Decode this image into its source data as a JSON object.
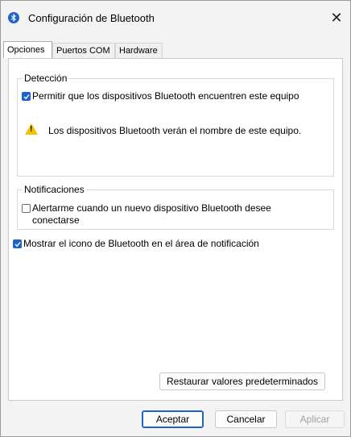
{
  "window": {
    "title": "Configuración de Bluetooth",
    "close_glyph": "✕"
  },
  "icons": {
    "app": "bluetooth-icon",
    "close": "close-icon",
    "warning": "warning-icon",
    "checkbox_check": "check-icon"
  },
  "tabs": [
    {
      "label": "Opciones",
      "active": true
    },
    {
      "label": "Puertos COM",
      "active": false
    },
    {
      "label": "Hardware",
      "active": false
    }
  ],
  "deteccion": {
    "legend": "Detección",
    "allow_discovery": {
      "label": "Permitir que los dispositivos Bluetooth encuentren este equipo",
      "checked": true
    },
    "warning_text": "Los dispositivos Bluetooth verán el nombre de este equipo."
  },
  "notificaciones": {
    "legend": "Notificaciones",
    "alert_new_device": {
      "label_line1": "Alertarme cuando un nuevo dispositivo Bluetooth desee",
      "label_line2": "conectarse",
      "checked": false
    }
  },
  "show_icon": {
    "label": "Mostrar el icono de Bluetooth en el área de notificación",
    "checked": true
  },
  "buttons": {
    "restore": "Restaurar valores predeterminados",
    "ok": "Aceptar",
    "cancel": "Cancelar",
    "apply": "Aplicar"
  },
  "colors": {
    "accent": "#1e64c8",
    "warning": "#f2c200"
  }
}
